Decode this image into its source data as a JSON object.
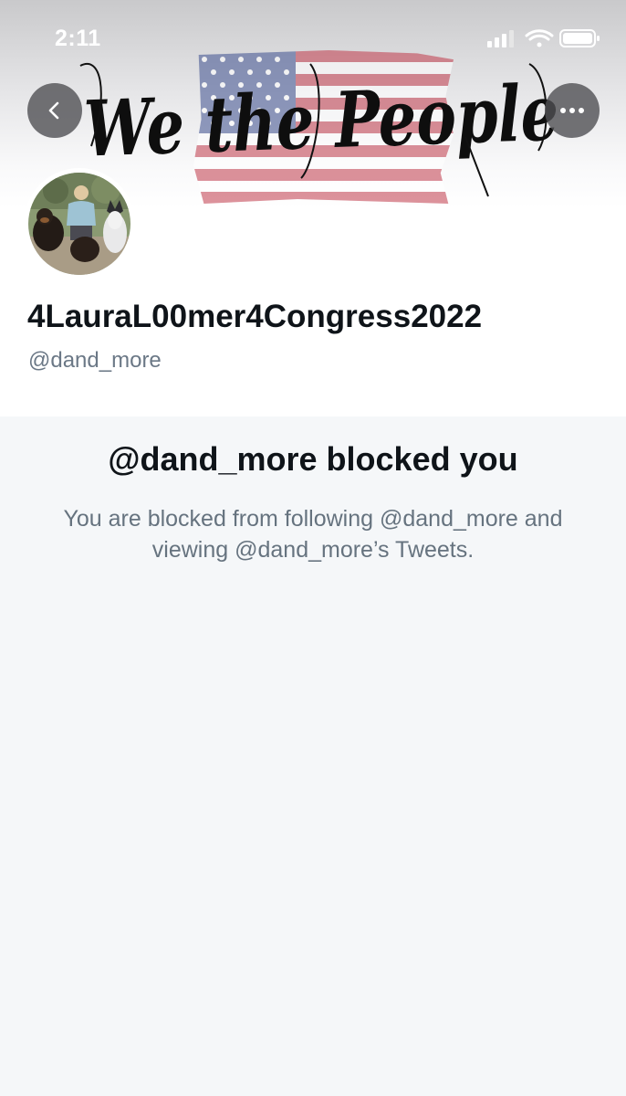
{
  "status_bar": {
    "time": "2:11",
    "icons": [
      "cellular-signal-icon",
      "wifi-icon",
      "battery-icon"
    ]
  },
  "header": {
    "banner_text": "We the People",
    "back_icon": "chevron-left-icon",
    "more_icon": "more-horizontal-icon"
  },
  "profile": {
    "display_name": "4LauraL00mer4Congress2022",
    "handle": "@dand_more"
  },
  "blocked": {
    "title": "@dand_more blocked you",
    "message": "You are blocked from following @dand_more and viewing @dand_more’s Tweets."
  },
  "colors": {
    "background": "#f5f7f9",
    "primary_text": "#0f1419",
    "secondary_text": "#66737f",
    "button_overlay": "#505054"
  }
}
